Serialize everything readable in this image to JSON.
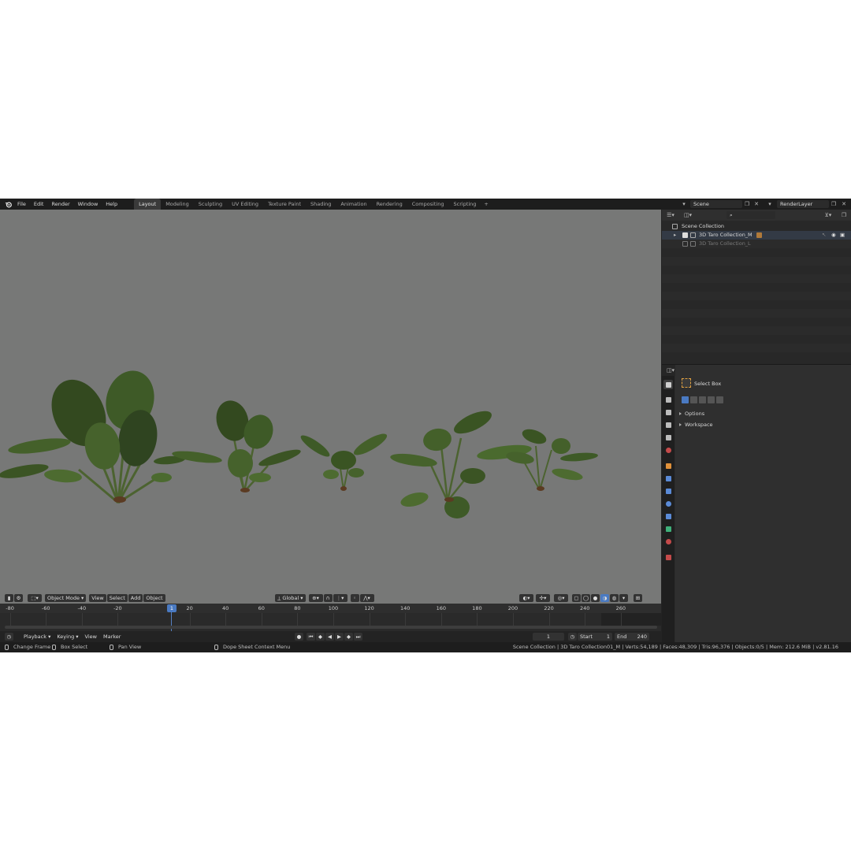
{
  "top_menu": [
    "File",
    "Edit",
    "Render",
    "Window",
    "Help"
  ],
  "workspace_tabs": [
    {
      "label": "Layout",
      "active": true
    },
    {
      "label": "Modeling",
      "active": false
    },
    {
      "label": "Sculpting",
      "active": false
    },
    {
      "label": "UV Editing",
      "active": false
    },
    {
      "label": "Texture Paint",
      "active": false
    },
    {
      "label": "Shading",
      "active": false
    },
    {
      "label": "Animation",
      "active": false
    },
    {
      "label": "Rendering",
      "active": false
    },
    {
      "label": "Compositing",
      "active": false
    },
    {
      "label": "Scripting",
      "active": false
    }
  ],
  "workspace_add": "+",
  "scene_name": "Scene",
  "view_layer": "RenderLayer",
  "viewport": {
    "mode": "Object Mode",
    "menus": [
      "View",
      "Select",
      "Add",
      "Object"
    ],
    "transform_orientation": "Global"
  },
  "timeline": {
    "ticks": [
      "-80",
      "-60",
      "-40",
      "-20",
      "20",
      "40",
      "60",
      "80",
      "100",
      "120",
      "140",
      "160",
      "180",
      "200",
      "220",
      "240",
      "260"
    ],
    "tick_values": [
      -80,
      -60,
      -40,
      -20,
      20,
      40,
      60,
      80,
      100,
      120,
      140,
      160,
      180,
      200,
      220,
      240,
      260
    ],
    "current_frame": "1",
    "current_frame_field": "1",
    "start_label": "Start",
    "start_value": "1",
    "end_label": "End",
    "end_value": "240",
    "menus": [
      "Playback",
      "Keying",
      "View",
      "Marker"
    ]
  },
  "outliner": {
    "root": "Scene Collection",
    "items": [
      {
        "label": "3D Taro Collection_M",
        "checked": true
      },
      {
        "label": "3D Taro Collection_L",
        "checked": false
      }
    ]
  },
  "properties": {
    "tool_name": "Select Box",
    "panels": [
      "Options",
      "Workspace"
    ]
  },
  "status": {
    "change_frame": "Change Frame",
    "box_select": "Box Select",
    "pan_view": "Pan View",
    "context_menu": "Dope Sheet Context Menu",
    "stats": "Scene Collection | 3D Taro Collection01_M | Verts:54,189 | Faces:48,309 | Tris:96,376 | Objects:0/5 | Mem: 212.6 MiB | v2.81.16"
  },
  "colors": {
    "accent": "#4a7ac2",
    "viewport_bg": "#777877",
    "leaf": "#3f5a2c",
    "leaf_light": "#5e7a3c",
    "leaf_dark": "#2c3f1e"
  }
}
